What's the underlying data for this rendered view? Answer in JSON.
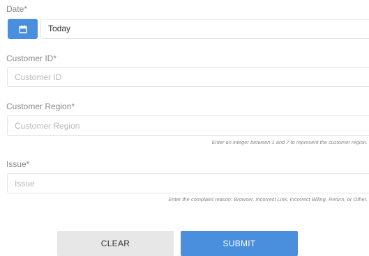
{
  "date": {
    "label": "Date*",
    "value": "Today",
    "icon": "calendar-icon"
  },
  "customer_id": {
    "label": "Customer ID*",
    "placeholder": "Customer ID"
  },
  "customer_region": {
    "label": "Customer Region*",
    "placeholder": "Customer Region",
    "hint": "Enter an integer between 1 and 7 to represent the customer region."
  },
  "issue": {
    "label": "Issue*",
    "placeholder": "Issue",
    "hint": "Enter the complaint reason: Browser, Incorrect Link, Incorrect Billing, Return, or Other."
  },
  "buttons": {
    "clear": "CLEAR",
    "submit": "SUBMIT"
  },
  "colors": {
    "accent": "#4a8fde",
    "clear_bg": "#e7e7e7"
  }
}
